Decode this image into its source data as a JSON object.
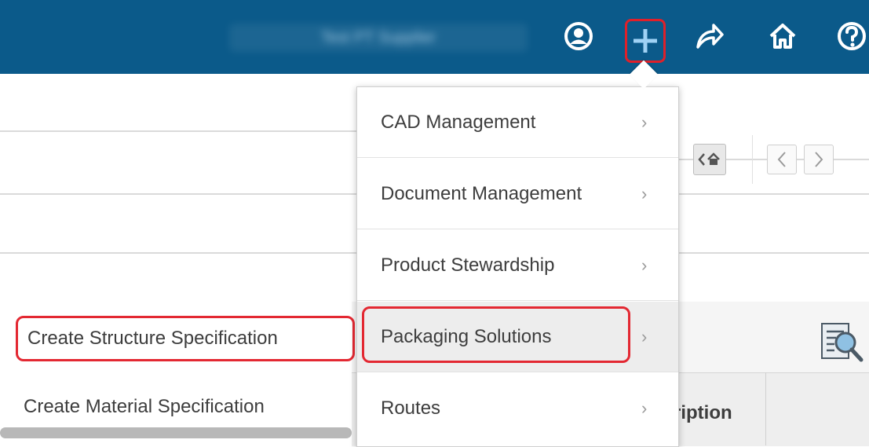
{
  "topbar": {
    "user_name": "Test PT Supplier",
    "icons": [
      "user-circle-icon",
      "plus-icon",
      "share-arrow-icon",
      "home-icon",
      "help-icon"
    ],
    "accent_color": "#0b5a8a"
  },
  "navigation": {
    "home_back_icon": "home-back-icon",
    "prev_icon": "chevron-left-icon",
    "next_icon": "chevron-right-icon"
  },
  "create_menu": {
    "items": [
      {
        "label": "CAD Management",
        "chevron": "›"
      },
      {
        "label": "Document Management",
        "chevron": "›"
      },
      {
        "label": "Product Stewardship",
        "chevron": "›"
      },
      {
        "label": "Packaging Solutions",
        "chevron": "›",
        "highlighted": true
      },
      {
        "label": "Routes",
        "chevron": "›"
      }
    ]
  },
  "submenu": {
    "items": [
      {
        "label": "Create Structure Specification",
        "highlighted": true
      },
      {
        "label": "Create Material Specification"
      }
    ]
  },
  "table": {
    "partial_column_header": "ription"
  },
  "highlight_color": "#e32832"
}
